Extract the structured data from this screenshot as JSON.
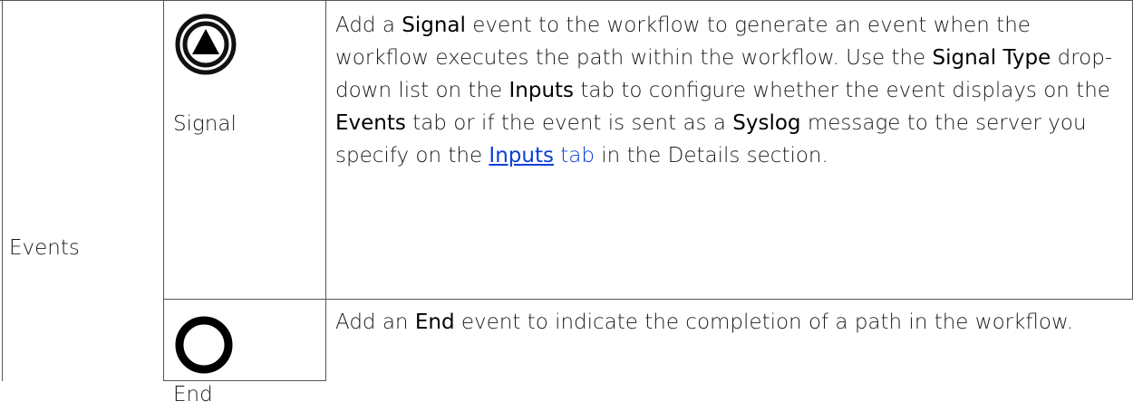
{
  "table": {
    "category": "Events",
    "rows": [
      {
        "name": "Signal",
        "icon": "signal-event-icon",
        "description": {
          "p1": "Add a ",
          "b1": "Signal",
          "p2": " event to the workflow to generate an event when the workflow executes the path within the workflow. Use the ",
          "b2": "Signal Type",
          "p3": " drop-down list on the ",
          "b3": "Inputs",
          "p4": " tab to configure whether the event displays on the ",
          "b4": "Events",
          "p5": " tab or if the event is sent as a ",
          "b5": "Syslog",
          "p6": " message to the server you specify on the ",
          "link_bold": "Inputs",
          "link_tail": " tab",
          "p7": " in the Details section."
        }
      },
      {
        "name": "End",
        "icon": "end-event-icon",
        "description": {
          "p1": "Add an ",
          "b1": "End",
          "p2": " event to indicate the completion of a path in the workflow."
        }
      }
    ]
  }
}
